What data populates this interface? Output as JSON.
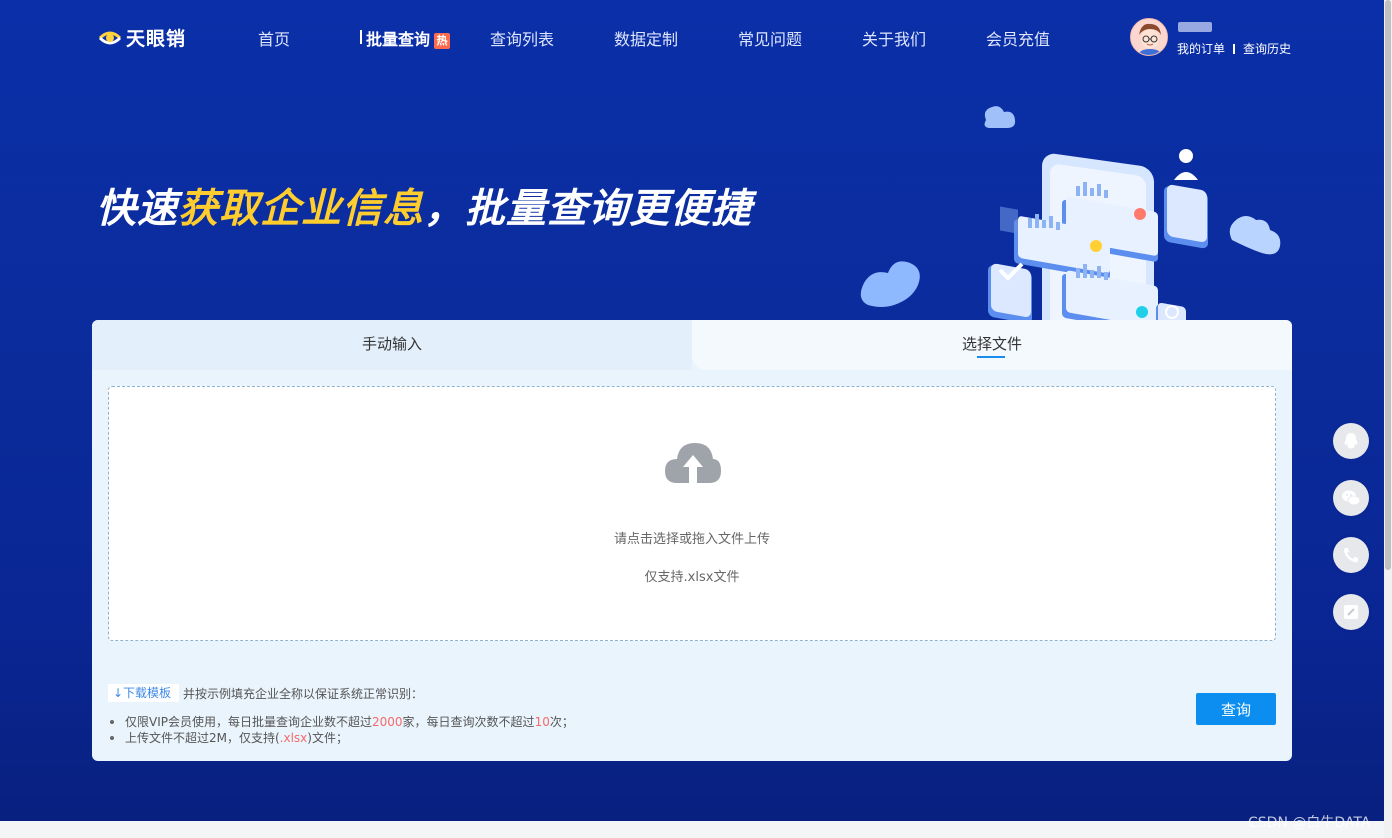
{
  "header": {
    "logo_text": "天眼销",
    "nav": [
      {
        "label": "首页"
      },
      {
        "label": "批量查询",
        "badge": "热",
        "active": true
      },
      {
        "label": "查询列表"
      },
      {
        "label": "数据定制"
      },
      {
        "label": "常见问题"
      },
      {
        "label": "关于我们"
      },
      {
        "label": "会员充值"
      }
    ],
    "user": {
      "orders_link": "我的订单",
      "history_link": "查询历史"
    }
  },
  "hero": {
    "slogan_part1": "快速",
    "slogan_highlight": "获取企业信息",
    "slogan_part2": "，批量查询更便捷"
  },
  "panel": {
    "tabs": [
      {
        "label": "手动输入"
      },
      {
        "label": "选择文件",
        "active": true
      }
    ],
    "upload": {
      "hint": "请点击选择或拖入文件上传",
      "formats": "仅支持.xlsx文件"
    },
    "download_template": "↓下载模板",
    "download_desc": "并按示例填充企业全称以保证系统正常识别：",
    "notes": {
      "line1_a": "仅限VIP会员使用，每日批量查询企业数不超过",
      "line1_limit": "2000",
      "line1_b": "家，每日查询次数不超过",
      "line1_times": "10",
      "line1_c": "次；",
      "line2_a": "上传文件不超过2M，仅支持(",
      "line2_ext": ".xlsx",
      "line2_b": ")文件；"
    },
    "query_button": "查询"
  },
  "side_tools": [
    "qq-icon",
    "wechat-icon",
    "phone-icon",
    "feedback-icon"
  ],
  "watermark": "CSDN @白牛DATA",
  "colors": {
    "hero_bg": "#0a2fa8",
    "highlight": "#ffcd2e",
    "primary_button": "#0b8ef0",
    "hot_badge": "#ff6a4d",
    "note_red": "#f56a6a"
  }
}
